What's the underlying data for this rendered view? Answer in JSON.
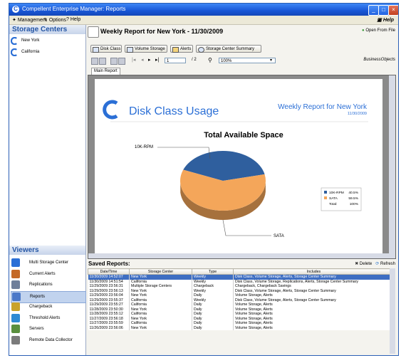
{
  "window": {
    "title": "Compellent Enterprise Manager: Reports"
  },
  "menu": {
    "items": [
      "Management",
      "Options",
      "Help"
    ],
    "help_right": "Help"
  },
  "storage_centers": {
    "heading": "Storage Centers",
    "items": [
      "New York",
      "California"
    ]
  },
  "viewers": {
    "heading": "Viewers",
    "items": [
      "Multi Storage Center",
      "Current Alerts",
      "Replications",
      "Reports",
      "Chargeback",
      "Threshold Alerts",
      "Servers",
      "Remote Data Collector"
    ],
    "active_index": 3,
    "icon_colors": [
      "#2b6fd6",
      "#c46a28",
      "#6f7f9a",
      "#4b78c8",
      "#c9a22a",
      "#2f8ad3",
      "#5a8f3e",
      "#7b7b7b"
    ]
  },
  "report": {
    "title": "Weekly Report for New York - 11/30/2009",
    "open_from_file": "Open From File",
    "tabs": [
      "Disk Class",
      "Volume Storage",
      "Alerts",
      "Storage Center Summary"
    ],
    "page_input": "1",
    "page_total": "/ 2",
    "zoom": "100%",
    "business_objects": "BusinessObjects",
    "main_tab": "Main Report"
  },
  "report_page": {
    "heading": "Disk Class Usage",
    "subheading": "Weekly Report for New York",
    "date": "11/30/2009",
    "chart_title": "Total Available Space",
    "label_top": "10K-RPM",
    "label_bottom": "SATA"
  },
  "chart_data": {
    "type": "pie",
    "title": "Total Available Space",
    "categories": [
      "10K-RPM",
      "SATA"
    ],
    "values": [
      40.5,
      59.5
    ],
    "colors": [
      "#2f5f9e",
      "#f4a65a"
    ],
    "legend": [
      {
        "label": "10K-RPM",
        "value": "40.5%"
      },
      {
        "label": "SATA",
        "value": "59.5%"
      },
      {
        "label": "Total:",
        "value": "100%"
      }
    ],
    "legend_position": "right"
  },
  "saved_reports": {
    "heading": "Saved Reports:",
    "delete_label": "Delete",
    "refresh_label": "Refresh",
    "columns": [
      "Date/Time",
      "Storage Center",
      "Type",
      "Includes"
    ],
    "rows": [
      [
        "11/30/2009 14:52:07",
        "New York",
        "Weekly",
        "Disk Class, Volume Storage, Alerts, Storage Center Summary"
      ],
      [
        "11/30/2009 14:51:54",
        "California",
        "Weekly",
        "Disk Class, Volume Storage, Replications, Alerts, Storage Center Summary"
      ],
      [
        "11/29/2009 23:56:31",
        "Multiple Storage Centers",
        "Chargeback",
        "Chargeback, Chargeback Savings"
      ],
      [
        "11/29/2009 23:56:13",
        "New York",
        "Weekly",
        "Disk Class, Volume Storage, Alerts, Storage Center Summary"
      ],
      [
        "11/29/2009 23:56:04",
        "New York",
        "Daily",
        "Volume Storage, Alerts"
      ],
      [
        "11/29/2009 23:55:37",
        "California",
        "Weekly",
        "Disk Class, Volume Storage, Alerts, Storage Center Summary"
      ],
      [
        "11/29/2009 23:55:27",
        "California",
        "Daily",
        "Volume Storage, Alerts"
      ],
      [
        "11/28/2009 23:50:30",
        "New York",
        "Daily",
        "Volume Storage, Alerts"
      ],
      [
        "11/28/2009 23:55:12",
        "California",
        "Daily",
        "Volume Storage, Alerts"
      ],
      [
        "11/27/2009 23:56:18",
        "New York",
        "Daily",
        "Volume Storage, Alerts"
      ],
      [
        "11/27/2009 23:55:59",
        "California",
        "Daily",
        "Volume Storage, Alerts"
      ],
      [
        "11/26/2009 23:56:06",
        "New York",
        "Daily",
        "Volume Storage, Alerts"
      ]
    ],
    "selected_index": 0
  }
}
